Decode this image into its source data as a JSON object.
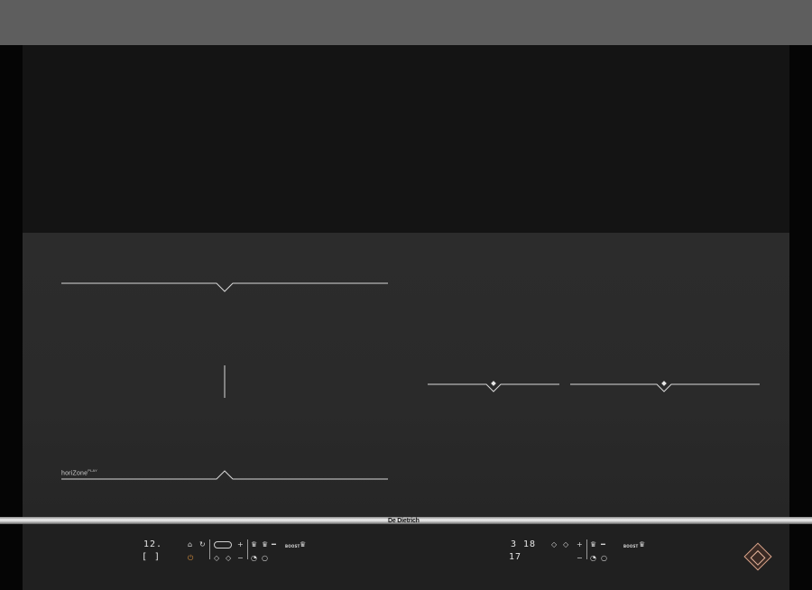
{
  "label": {
    "horizone_name": "horiZone",
    "horizone_suffix": "PLAY",
    "brand": "De Dietrich"
  },
  "left_panel": {
    "display_top": "12.",
    "display_bottom": "[ ]",
    "lock_icon": "⌂",
    "timer_icon": "↻",
    "power_icon": "⏻",
    "plus": "+",
    "minus": "−",
    "boost_label": "BOOST"
  },
  "right_panel": {
    "display_top": "3 18",
    "display_bottom": "17",
    "plus": "+",
    "minus": "−",
    "boost_label": "BOOST"
  },
  "colors": {
    "glass": "#2a2a2a",
    "accent_power": "#d08a3c",
    "logo": "#d9a48a"
  }
}
